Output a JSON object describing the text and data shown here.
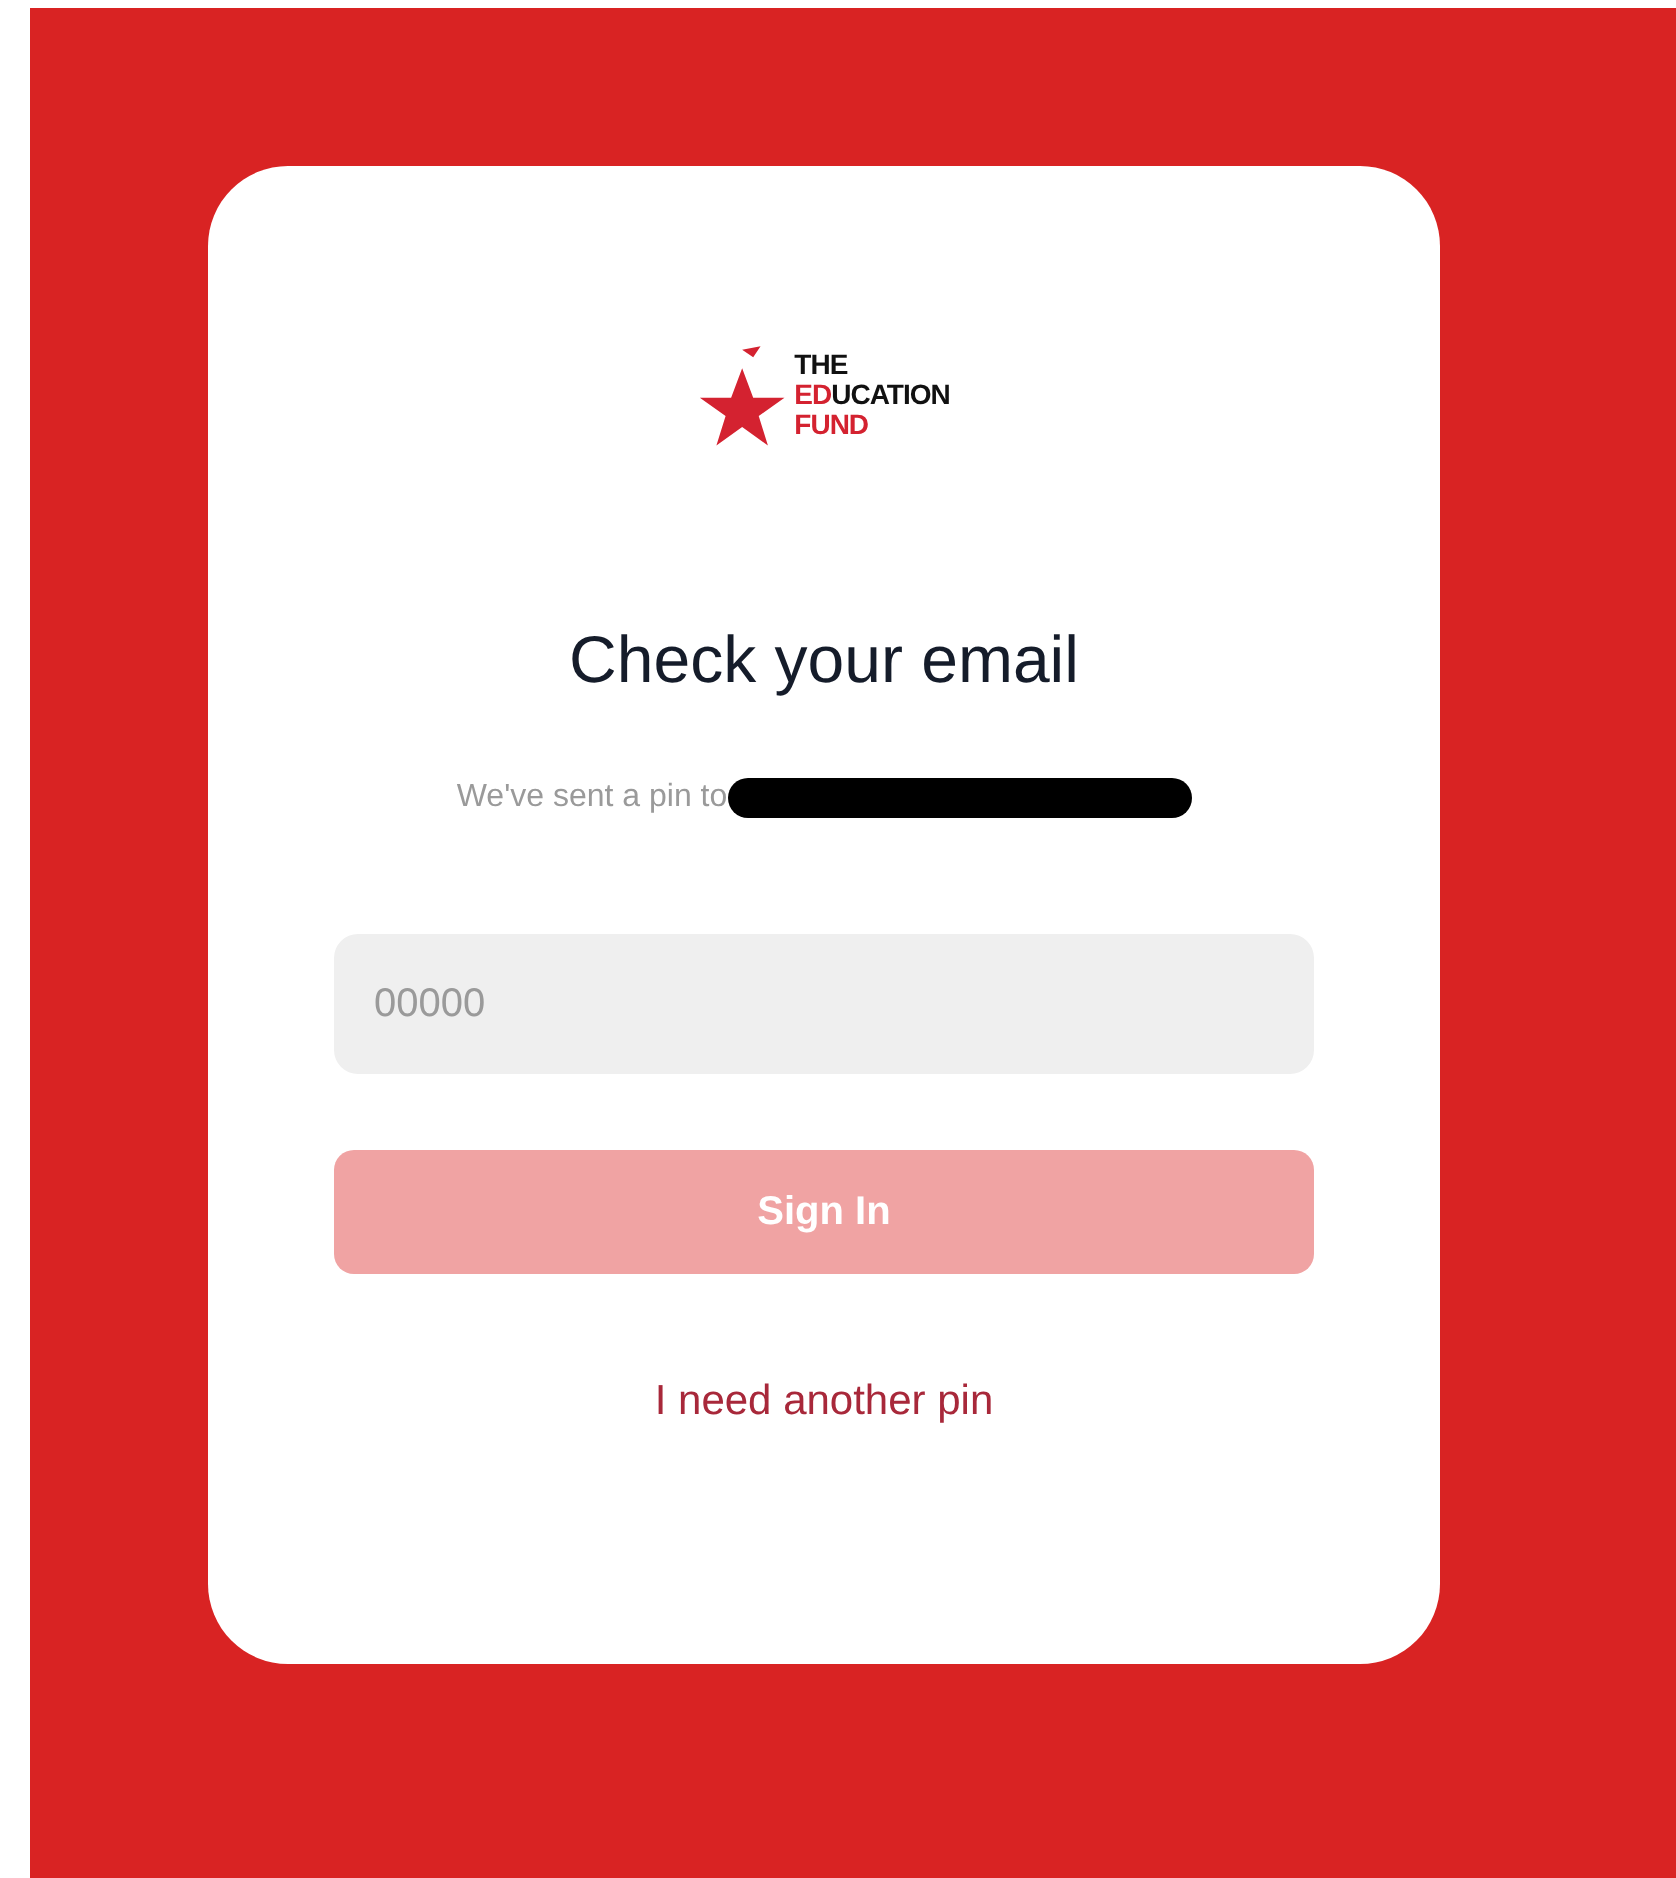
{
  "logo": {
    "line_1": "THE",
    "line_2_highlight": "ED",
    "line_2_rest": "UCATION",
    "line_3": "FUND"
  },
  "heading": "Check your email",
  "message": {
    "text": "We've sent a pin to",
    "email_redacted": true
  },
  "pin_field": {
    "placeholder": "00000"
  },
  "sign_in_button": {
    "label": "Sign In",
    "disabled": true
  },
  "resend_link": "I need another pin"
}
